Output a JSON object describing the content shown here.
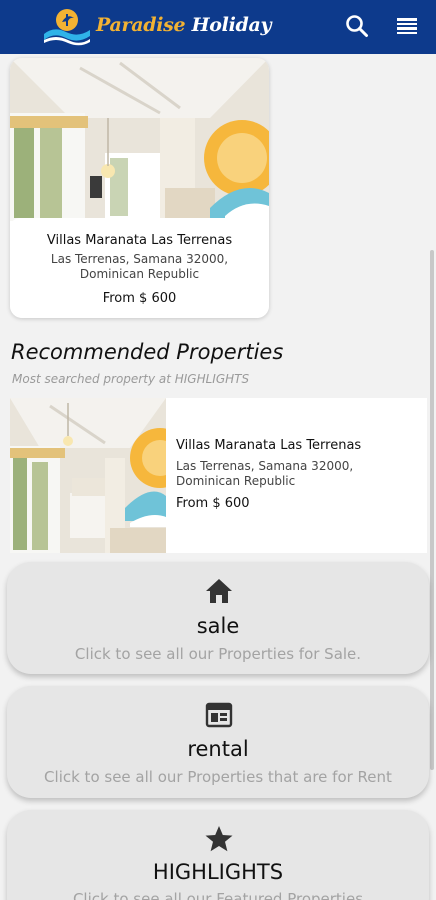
{
  "app": {
    "brand_word1": "Paradise",
    "brand_word2": "Holiday",
    "search_icon": "search-icon",
    "menu_icon": "menu-icon",
    "colors": {
      "header": "#0d3a8c",
      "brand_accent": "#f2b233"
    }
  },
  "featured": {
    "title": "Villas Maranata Las Terrenas",
    "address": "Las Terrenas, Samana 32000, Dominican Republic",
    "price": "From $ 600"
  },
  "recommended": {
    "heading": "Recommended Properties",
    "subheading": "Most searched property at HIGHLIGHTS",
    "item": {
      "title": "Villas Maranata Las Terrenas",
      "address": "Las Terrenas, Samana 32000, Dominican Republic",
      "price": "From $ 600"
    }
  },
  "categories": [
    {
      "icon": "home-icon",
      "label": "sale",
      "desc": "Click to see all our Properties for Sale."
    },
    {
      "icon": "rental-calendar-icon",
      "label": "rental",
      "desc": "Click to see all our Properties that are for Rent"
    },
    {
      "icon": "star-icon",
      "label": "HIGHLIGHTS",
      "desc": "Click to see all our Featured Properties"
    }
  ]
}
